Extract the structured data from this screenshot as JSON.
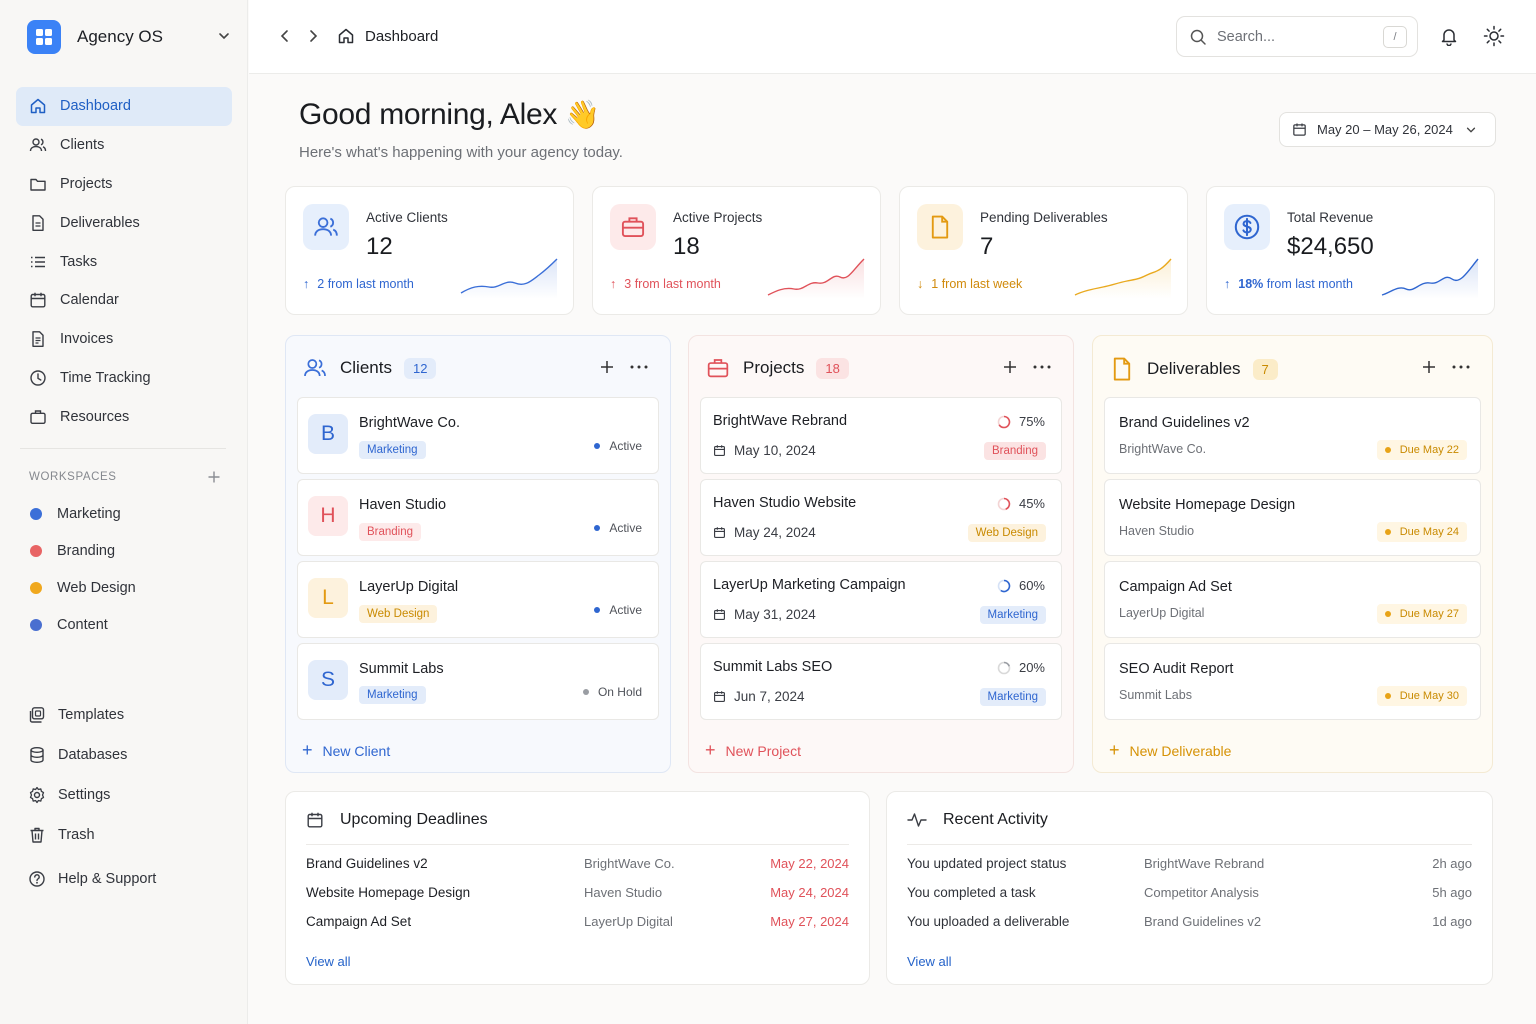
{
  "app": {
    "name": "Agency OS"
  },
  "sidebar": {
    "items": [
      {
        "label": "Dashboard",
        "icon": "home-icon",
        "active": true
      },
      {
        "label": "Clients",
        "icon": "users-icon"
      },
      {
        "label": "Projects",
        "icon": "folder-icon"
      },
      {
        "label": "Deliverables",
        "icon": "document-icon"
      },
      {
        "label": "Tasks",
        "icon": "list-icon"
      },
      {
        "label": "Calendar",
        "icon": "calendar-icon"
      },
      {
        "label": "Invoices",
        "icon": "invoice-icon"
      },
      {
        "label": "Time Tracking",
        "icon": "clock-icon"
      },
      {
        "label": "Resources",
        "icon": "briefcase-icon"
      }
    ],
    "workspaces_title": "WORKSPACES",
    "workspaces": [
      {
        "label": "Marketing",
        "color": "#3b6fd8"
      },
      {
        "label": "Branding",
        "color": "#e86464"
      },
      {
        "label": "Web Design",
        "color": "#f0a81e"
      },
      {
        "label": "Content",
        "color": "#4a6fd0"
      }
    ],
    "bottom": [
      {
        "label": "Templates",
        "icon": "templates-icon"
      },
      {
        "label": "Databases",
        "icon": "database-icon"
      },
      {
        "label": "Settings",
        "icon": "gear-icon"
      },
      {
        "label": "Trash",
        "icon": "trash-icon"
      },
      {
        "label": "Help & Support",
        "icon": "help-icon"
      }
    ]
  },
  "topbar": {
    "title": "Dashboard",
    "search_placeholder": "Search...",
    "search_shortcut": "/"
  },
  "header": {
    "greeting": "Good morning, Alex",
    "emoji": "👋",
    "subtitle": "Here's what's happening with your agency today.",
    "date_range": "May 20 – May 26, 2024"
  },
  "stats": [
    {
      "label": "Active Clients",
      "value": "12",
      "trend_strong": "2",
      "trend_text": "from last month",
      "color": "#3b6fd8",
      "icon": "users-icon"
    },
    {
      "label": "Active Projects",
      "value": "18",
      "trend_strong": "3",
      "trend_text": "from last month",
      "color": "#e0525a",
      "icon": "briefcase-icon"
    },
    {
      "label": "Pending Deliverables",
      "value": "7",
      "trend_strong": "1",
      "trend_text": "from last week",
      "color": "#e39a12",
      "icon": "document-icon"
    },
    {
      "label": "Total Revenue",
      "value": "$24,650",
      "trend_strong": "18%",
      "trend_text": "from last month",
      "color": "#2f66d0",
      "icon": "dollar-icon"
    }
  ],
  "clients": {
    "title": "Clients",
    "count": "12",
    "add_label": "New Client",
    "items": [
      {
        "initial": "B",
        "name": "BrightWave Co.",
        "tag": "Marketing",
        "status": "Active"
      },
      {
        "initial": "H",
        "name": "Haven Studio",
        "tag": "Branding",
        "status": "Active"
      },
      {
        "initial": "L",
        "name": "LayerUp Digital",
        "tag": "Web Design",
        "status": "Active"
      },
      {
        "initial": "S",
        "name": "Summit Labs",
        "tag": "Marketing",
        "status": "On Hold"
      }
    ]
  },
  "projects": {
    "title": "Projects",
    "count": "18",
    "add_label": "New Project",
    "items": [
      {
        "name": "BrightWave Rebrand",
        "date": "May 10, 2024",
        "progress": "75%",
        "tag": "Branding"
      },
      {
        "name": "Haven Studio Website",
        "date": "May 24, 2024",
        "progress": "45%",
        "tag": "Web Design"
      },
      {
        "name": "LayerUp Marketing Campaign",
        "date": "May 31, 2024",
        "progress": "60%",
        "tag": "Marketing"
      },
      {
        "name": "Summit Labs SEO",
        "date": "Jun 7, 2024",
        "progress": "20%",
        "tag": "Marketing"
      }
    ]
  },
  "deliverables": {
    "title": "Deliverables",
    "count": "7",
    "add_label": "New Deliverable",
    "items": [
      {
        "name": "Brand Guidelines v2",
        "client": "BrightWave Co.",
        "due": "Due May 22"
      },
      {
        "name": "Website Homepage Design",
        "client": "Haven Studio",
        "due": "Due May 24"
      },
      {
        "name": "Campaign Ad Set",
        "client": "LayerUp Digital",
        "due": "Due May 27"
      },
      {
        "name": "SEO Audit Report",
        "client": "Summit Labs",
        "due": "Due May 30"
      }
    ]
  },
  "deadlines": {
    "title": "Upcoming Deadlines",
    "view_all": "View all",
    "rows": [
      {
        "name": "Brand Guidelines v2",
        "client": "BrightWave Co.",
        "date": "May 22, 2024"
      },
      {
        "name": "Website Homepage Design",
        "client": "Haven Studio",
        "date": "May 24, 2024"
      },
      {
        "name": "Campaign Ad Set",
        "client": "LayerUp Digital",
        "date": "May 27, 2024"
      }
    ]
  },
  "activity": {
    "title": "Recent Activity",
    "view_all": "View all",
    "rows": [
      {
        "action": "You updated project status",
        "target": "BrightWave Rebrand",
        "time": "2h ago"
      },
      {
        "action": "You completed a task",
        "target": "Competitor Analysis",
        "time": "5h ago"
      },
      {
        "action": "You uploaded a deliverable",
        "target": "Brand Guidelines v2",
        "time": "1d ago"
      }
    ]
  }
}
